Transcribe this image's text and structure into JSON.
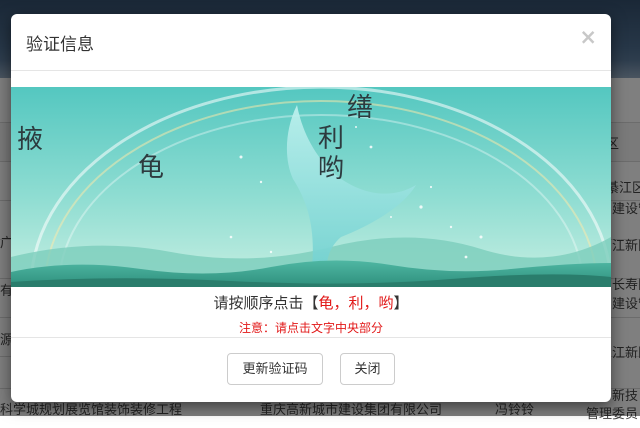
{
  "background": {
    "rows": [
      {
        "right_text": "区"
      },
      {
        "left_text": "广",
        "right_text": "綦江区"
      },
      {
        "left_text": "",
        "right_text": "建设管"
      },
      {
        "left_text": "有",
        "right_text": "江新区"
      },
      {
        "left_text": "源",
        "right_text": "长寿区"
      },
      {
        "left_text": "",
        "right_text": "建设管"
      },
      {
        "left_text": "",
        "right_text": "江新区"
      },
      {
        "left_text": "科学城规划展览馆装饰装修工程",
        "mid_text": "重庆高新城市建设集团有限公司",
        "person": "冯铃铃",
        "right_text": "新技"
      }
    ],
    "bottom_right": "管理委员"
  },
  "modal": {
    "title": "验证信息",
    "close_glyph": "×",
    "captcha_chars": [
      "掖",
      "龟",
      "缮",
      "利",
      "哟"
    ],
    "instruction_prefix": "请按顺序点击",
    "instruction_open": "【",
    "instruction_sequence": "龟，利，哟",
    "instruction_close": "】",
    "note": "注意：请点击文字中央部分",
    "refresh_label": "更新验证码",
    "close_label": "关闭"
  }
}
